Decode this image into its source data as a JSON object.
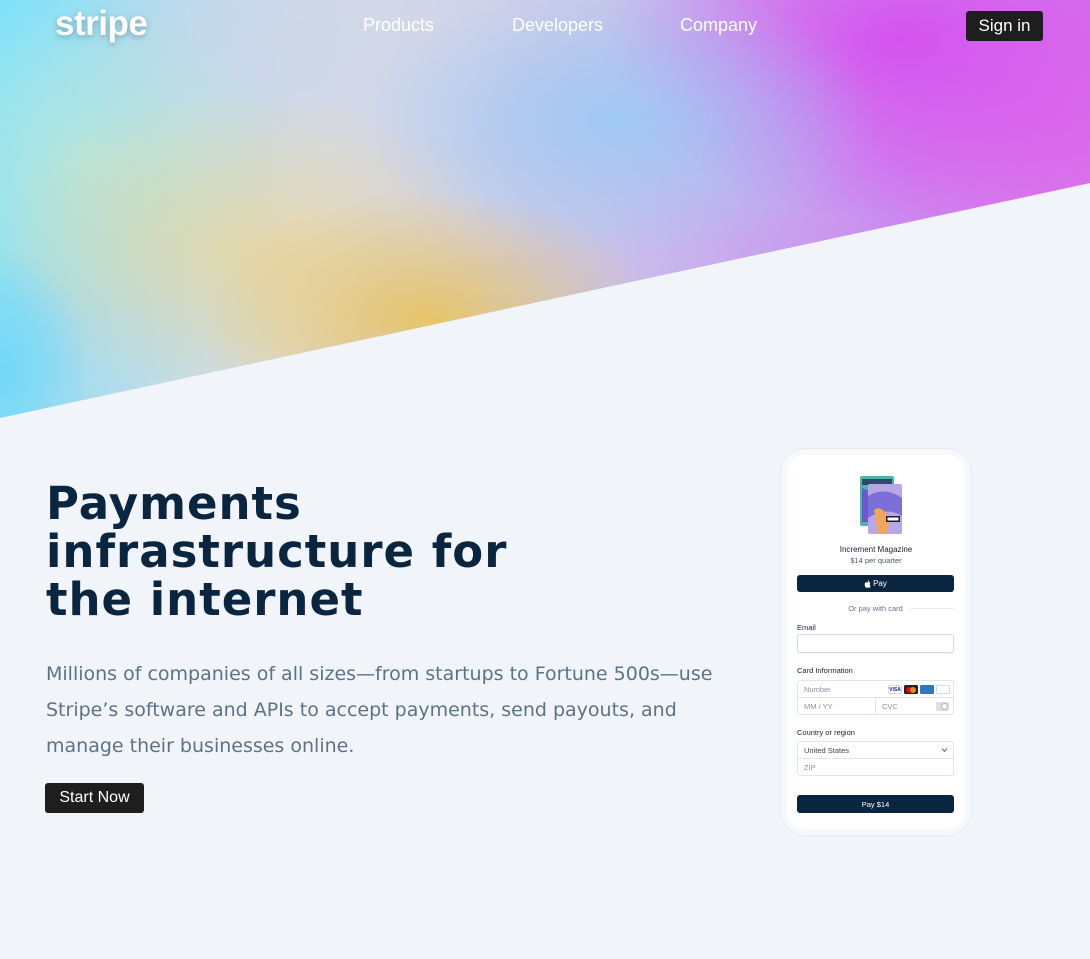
{
  "nav": {
    "logo": "stripe",
    "links": [
      "Products",
      "Developers",
      "Company"
    ],
    "signin_label": "Sign in"
  },
  "hero": {
    "title": "Payments infrastructure for the internet",
    "description": "Millions of companies of all sizes—from startups to Fortune 500s—use Stripe’s software and APIs to accept payments, send payouts, and manage their businesses online.",
    "cta_label": "Start Now"
  },
  "checkout": {
    "product_name": "Increment Magazine",
    "product_price": "$14 per quarter",
    "applepay_label": "Pay",
    "divider_text": "Or pay with card",
    "email_label": "Email",
    "card_label": "Card Information",
    "card_number_placeholder": "Number",
    "expiry_placeholder": "MM / YY",
    "cvc_placeholder": "CVC",
    "country_label": "Country or region",
    "country_value": "United States",
    "zip_placeholder": "ZIP",
    "pay_label": "Pay $14",
    "card_brands": [
      "visa",
      "mastercard",
      "amex",
      "discover"
    ]
  },
  "colors": {
    "navy": "#0a2540",
    "button_dark": "#1e1e1e",
    "body_text": "#5b7388",
    "page_bg": "#f1f4f8"
  }
}
